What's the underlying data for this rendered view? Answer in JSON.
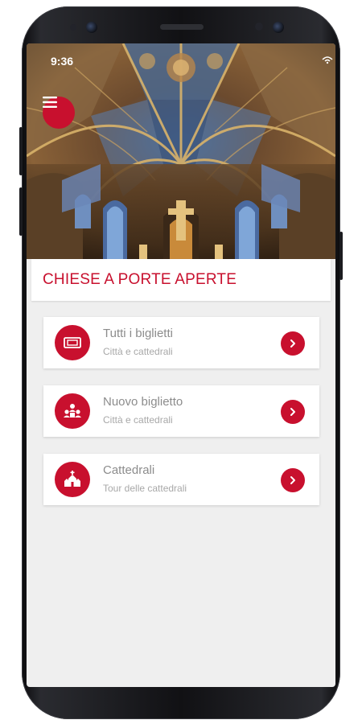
{
  "status": {
    "time": "9:36"
  },
  "header": {
    "title": "CHIESE A PORTE APERTE"
  },
  "menu": {
    "icon": "hamburger-icon"
  },
  "items": [
    {
      "label": "Tutti i biglietti",
      "sublabel": "Città e cattedrali",
      "icon": "ticket-icon"
    },
    {
      "label": "Nuovo biglietto",
      "sublabel": "Città e cattedrali",
      "icon": "people-icon"
    },
    {
      "label": "Cattedrali",
      "sublabel": "Tour delle cattedrali",
      "icon": "cathedral-icon"
    }
  ],
  "colors": {
    "accent": "#c8102e",
    "background": "#efefef"
  }
}
